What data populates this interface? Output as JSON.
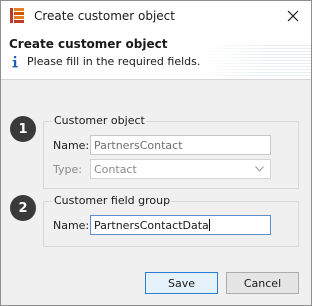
{
  "window": {
    "title": "Create customer object",
    "app_icon": "app-icon",
    "close_icon": "close-icon"
  },
  "header": {
    "title": "Create customer object",
    "info_icon": "info-icon",
    "message": "Please fill in the required fields."
  },
  "groups": [
    {
      "badge": "1",
      "title": "Customer object",
      "fields": [
        {
          "label": "Name:",
          "value": "PartnersContact"
        },
        {
          "label": "Type:",
          "value": "Contact",
          "options_visible": [
            "Contact"
          ]
        }
      ]
    },
    {
      "badge": "2",
      "title": "Customer field group",
      "fields": [
        {
          "label": "Name:",
          "value": "PartnersContactData"
        }
      ]
    }
  ],
  "buttons": {
    "save": "Save",
    "cancel": "Cancel"
  },
  "colors": {
    "badge_bg": "#3a3a3a",
    "default_button_border": "#2a7fd4",
    "dialog_bg": "#f0f0f0"
  }
}
